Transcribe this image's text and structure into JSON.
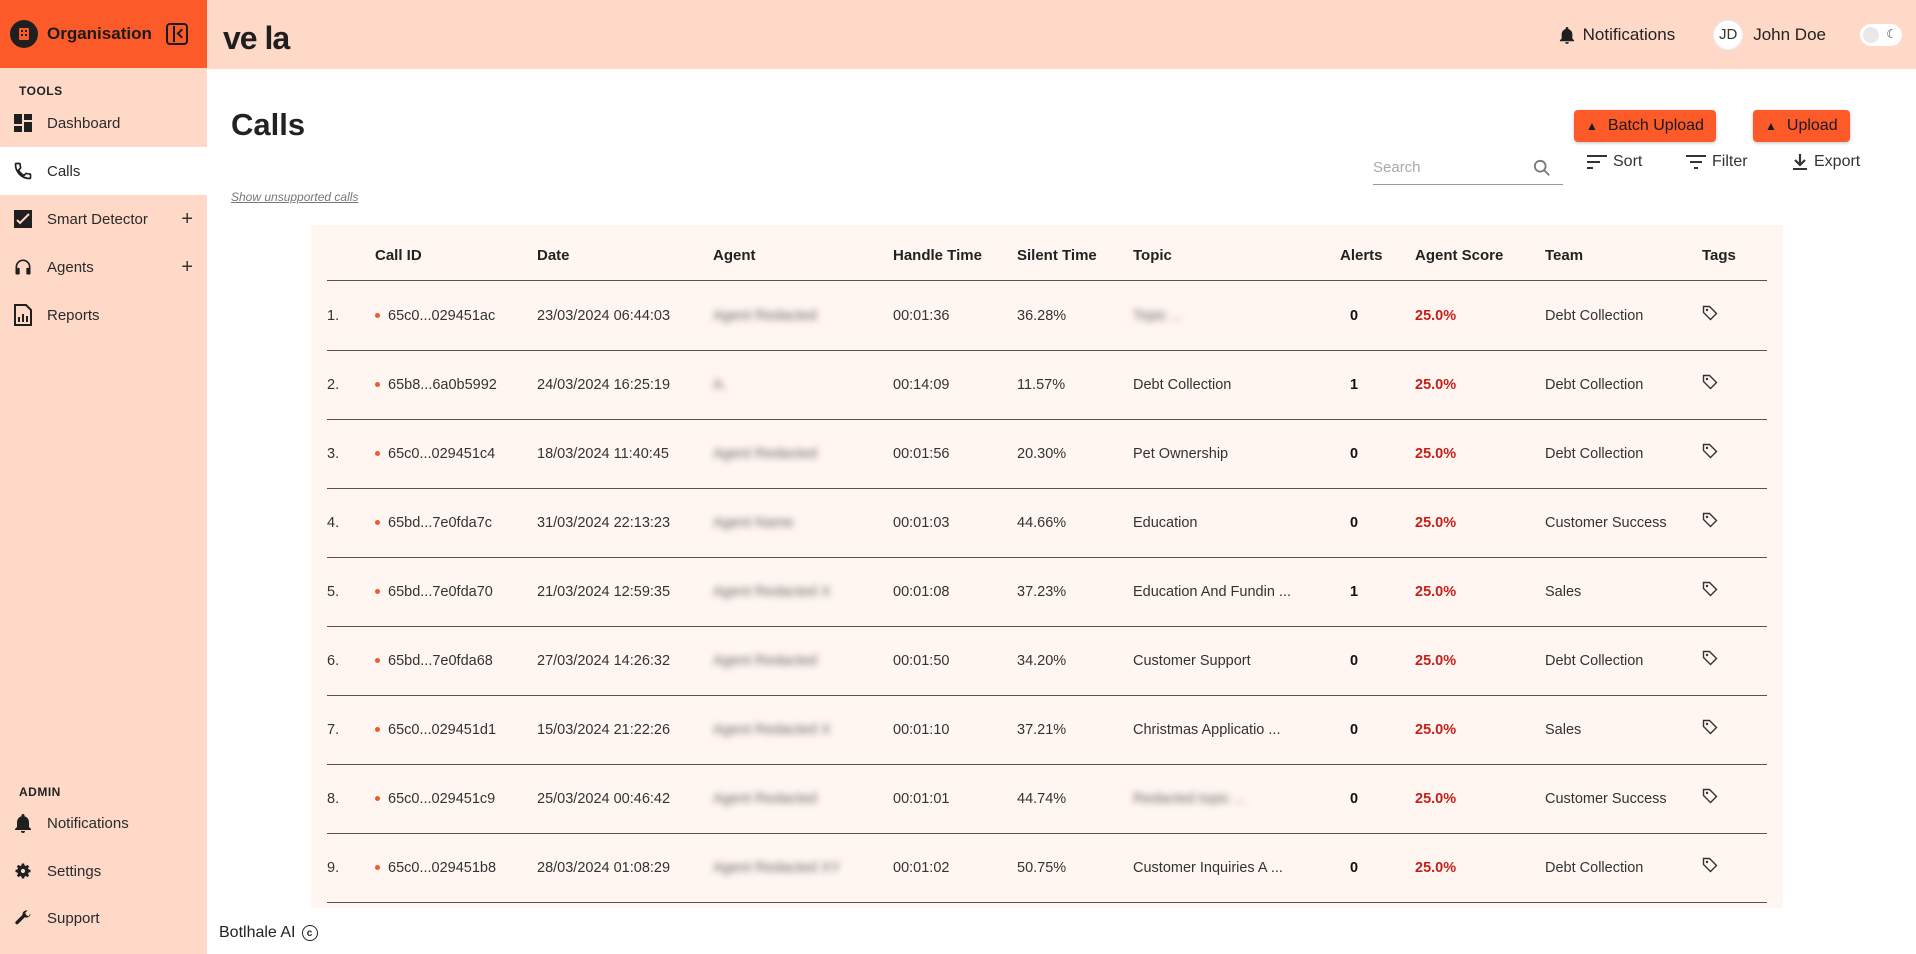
{
  "org": {
    "name": "Organisation"
  },
  "brand": {
    "text": "ve la"
  },
  "sidebar": {
    "tools_label": "TOOLS",
    "admin_label": "ADMIN",
    "items": [
      {
        "label": "Dashboard",
        "icon": "dashboard-icon"
      },
      {
        "label": "Calls",
        "icon": "phone-icon"
      },
      {
        "label": "Smart Detector",
        "icon": "chart-check-icon"
      },
      {
        "label": "Agents",
        "icon": "headset-icon"
      },
      {
        "label": "Reports",
        "icon": "report-icon"
      }
    ],
    "admin_items": [
      {
        "label": "Notifications",
        "icon": "bell-icon"
      },
      {
        "label": "Settings",
        "icon": "gear-icon"
      },
      {
        "label": "Support",
        "icon": "wrench-icon"
      }
    ]
  },
  "header": {
    "notifications_label": "Notifications",
    "user_initials": "JD",
    "user_name": "John Doe"
  },
  "main": {
    "title": "Calls",
    "batch_upload_label": "Batch Upload",
    "upload_label": "Upload",
    "search_placeholder": "Search",
    "sort_label": "Sort",
    "filter_label": "Filter",
    "export_label": "Export",
    "unsupported_link": "Show unsupported calls"
  },
  "table": {
    "columns": [
      "Call ID",
      "Date",
      "Agent",
      "Handle Time",
      "Silent Time",
      "Topic",
      "Alerts",
      "Agent Score",
      "Team",
      "Tags"
    ],
    "rows": [
      {
        "num": "1.",
        "call_id": "65c0...029451ac",
        "date": "23/03/2024 06:44:03",
        "agent": "Agent Redacted",
        "handle": "00:01:36",
        "silent": "36.28%",
        "topic": "Topic ...",
        "topic_blur": true,
        "alerts": "0",
        "score": "25.0%",
        "team": "Debt Collection"
      },
      {
        "num": "2.",
        "call_id": "65b8...6a0b5992",
        "date": "24/03/2024 16:25:19",
        "agent": "A.",
        "handle": "00:14:09",
        "silent": "11.57%",
        "topic": "Debt Collection",
        "topic_blur": false,
        "alerts": "1",
        "score": "25.0%",
        "team": "Debt Collection"
      },
      {
        "num": "3.",
        "call_id": "65c0...029451c4",
        "date": "18/03/2024 11:40:45",
        "agent": "Agent Redacted",
        "handle": "00:01:56",
        "silent": "20.30%",
        "topic": "Pet Ownership",
        "topic_blur": false,
        "alerts": "0",
        "score": "25.0%",
        "team": "Debt Collection"
      },
      {
        "num": "4.",
        "call_id": "65bd...7e0fda7c",
        "date": "31/03/2024 22:13:23",
        "agent": "Agent Name",
        "handle": "00:01:03",
        "silent": "44.66%",
        "topic": "Education",
        "topic_blur": false,
        "alerts": "0",
        "score": "25.0%",
        "team": "Customer Success"
      },
      {
        "num": "5.",
        "call_id": "65bd...7e0fda70",
        "date": "21/03/2024 12:59:35",
        "agent": "Agent Redacted X",
        "handle": "00:01:08",
        "silent": "37.23%",
        "topic": "Education And Fundin ...",
        "topic_blur": false,
        "alerts": "1",
        "score": "25.0%",
        "team": "Sales"
      },
      {
        "num": "6.",
        "call_id": "65bd...7e0fda68",
        "date": "27/03/2024 14:26:32",
        "agent": "Agent Redacted",
        "handle": "00:01:50",
        "silent": "34.20%",
        "topic": "Customer Support",
        "topic_blur": false,
        "alerts": "0",
        "score": "25.0%",
        "team": "Debt Collection"
      },
      {
        "num": "7.",
        "call_id": "65c0...029451d1",
        "date": "15/03/2024 21:22:26",
        "agent": "Agent Redacted X",
        "handle": "00:01:10",
        "silent": "37.21%",
        "topic": "Christmas Applicatio ...",
        "topic_blur": false,
        "alerts": "0",
        "score": "25.0%",
        "team": "Sales"
      },
      {
        "num": "8.",
        "call_id": "65c0...029451c9",
        "date": "25/03/2024 00:46:42",
        "agent": "Agent Redacted",
        "handle": "00:01:01",
        "silent": "44.74%",
        "topic": "Redacted topic ...",
        "topic_blur": true,
        "alerts": "0",
        "score": "25.0%",
        "team": "Customer Success"
      },
      {
        "num": "9.",
        "call_id": "65c0...029451b8",
        "date": "28/03/2024 01:08:29",
        "agent": "Agent Redacted XY",
        "handle": "00:01:02",
        "silent": "50.75%",
        "topic": "Customer Inquiries A ...",
        "topic_blur": false,
        "alerts": "0",
        "score": "25.0%",
        "team": "Debt Collection"
      }
    ]
  },
  "footer": {
    "text": "Botlhale AI"
  },
  "colors": {
    "accent": "#fd5a2a",
    "sidebar_bg": "#fed9c8",
    "score": "#c4201b"
  }
}
